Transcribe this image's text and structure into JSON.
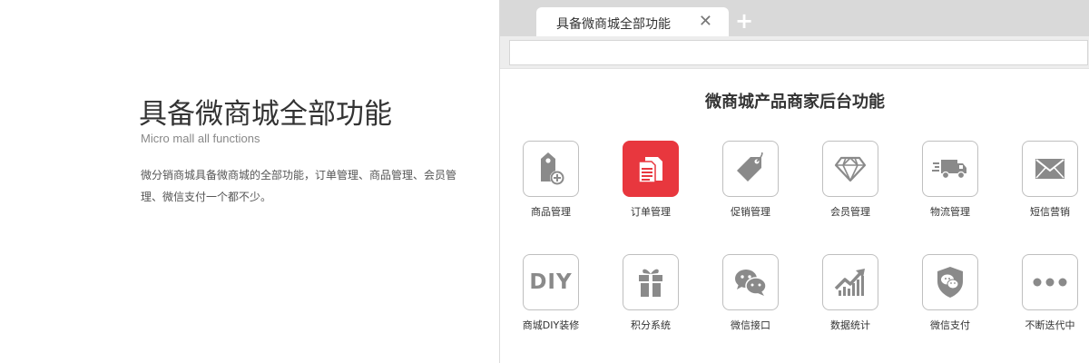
{
  "intro": {
    "title": "具备微商城全部功能",
    "subtitle": "Micro mall all functions",
    "description": "微分销商城具备微商城的全部功能，订单管理、商品管理、会员管理、微信支付一个都不少。"
  },
  "browser": {
    "tab_title": "具备微商城全部功能",
    "close_glyph": "✕",
    "new_tab_glyph": "+",
    "address_value": ""
  },
  "panel": {
    "title": "微商城产品商家后台功能",
    "features": [
      {
        "label": "商品管理",
        "icon": "product-tag-add-icon",
        "active": false
      },
      {
        "label": "订单管理",
        "icon": "order-documents-icon",
        "active": true
      },
      {
        "label": "促销管理",
        "icon": "price-tag-icon",
        "active": false
      },
      {
        "label": "会员管理",
        "icon": "diamond-icon",
        "active": false
      },
      {
        "label": "物流管理",
        "icon": "delivery-truck-icon",
        "active": false
      },
      {
        "label": "短信营销",
        "icon": "envelope-icon",
        "active": false
      },
      {
        "label": "商城DIY装修",
        "icon": "diy-text-icon",
        "active": false
      },
      {
        "label": "积分系统",
        "icon": "gift-icon",
        "active": false
      },
      {
        "label": "微信接口",
        "icon": "wechat-icon",
        "active": false
      },
      {
        "label": "数据统计",
        "icon": "bar-chart-trend-icon",
        "active": false
      },
      {
        "label": "微信支付",
        "icon": "wechat-shield-icon",
        "active": false
      },
      {
        "label": "不断迭代中",
        "icon": "more-dots-icon",
        "active": false
      }
    ],
    "colors": {
      "active": "#e8373e",
      "icon": "#8a8a8a",
      "border": "#bfbfbf"
    },
    "diy_text": "DIY"
  }
}
